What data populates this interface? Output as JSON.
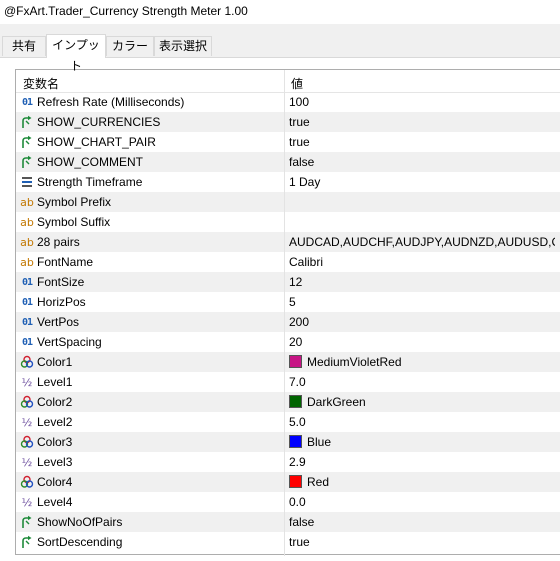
{
  "window": {
    "title": "@FxArt.Trader_Currency Strength Meter 1.00"
  },
  "tabs": [
    {
      "label": "共有"
    },
    {
      "label": "インプット"
    },
    {
      "label": "カラー"
    },
    {
      "label": "表示選択"
    }
  ],
  "grid": {
    "header_name": "変数名",
    "header_value": "値",
    "rows": [
      {
        "name": "Refresh Rate (Milliseconds)",
        "value": "100",
        "icon": "int-icon"
      },
      {
        "name": "SHOW_CURRENCIES",
        "value": "true",
        "icon": "bool-icon"
      },
      {
        "name": "SHOW_CHART_PAIR",
        "value": "true",
        "icon": "bool-icon"
      },
      {
        "name": "SHOW_COMMENT",
        "value": "false",
        "icon": "bool-icon"
      },
      {
        "name": "Strength Timeframe",
        "value": "1 Day",
        "icon": "enum-icon"
      },
      {
        "name": "Symbol Prefix",
        "value": "",
        "icon": "string-icon"
      },
      {
        "name": "Symbol Suffix",
        "value": "",
        "icon": "string-icon"
      },
      {
        "name": "28 pairs",
        "value": "AUDCAD,AUDCHF,AUDJPY,AUDNZD,AUDUSD,C...",
        "icon": "string-icon"
      },
      {
        "name": "FontName",
        "value": "Calibri",
        "icon": "string-icon"
      },
      {
        "name": "FontSize",
        "value": "12",
        "icon": "int-icon"
      },
      {
        "name": "HorizPos",
        "value": "5",
        "icon": "int-icon"
      },
      {
        "name": "VertPos",
        "value": "200",
        "icon": "int-icon"
      },
      {
        "name": "VertSpacing",
        "value": "20",
        "icon": "int-icon"
      },
      {
        "name": "Color1",
        "value": "MediumVioletRed",
        "icon": "color-icon",
        "swatch": "#c71585"
      },
      {
        "name": "Level1",
        "value": "7.0",
        "icon": "double-icon"
      },
      {
        "name": "Color2",
        "value": "DarkGreen",
        "icon": "color-icon",
        "swatch": "#006400"
      },
      {
        "name": "Level2",
        "value": "5.0",
        "icon": "double-icon"
      },
      {
        "name": "Color3",
        "value": "Blue",
        "icon": "color-icon",
        "swatch": "#0000ff"
      },
      {
        "name": "Level3",
        "value": "2.9",
        "icon": "double-icon"
      },
      {
        "name": "Color4",
        "value": "Red",
        "icon": "color-icon",
        "swatch": "#ff0000"
      },
      {
        "name": "Level4",
        "value": "0.0",
        "icon": "double-icon"
      },
      {
        "name": "ShowNoOfPairs",
        "value": "false",
        "icon": "bool-icon"
      },
      {
        "name": "SortDescending",
        "value": "true",
        "icon": "bool-icon"
      }
    ]
  }
}
